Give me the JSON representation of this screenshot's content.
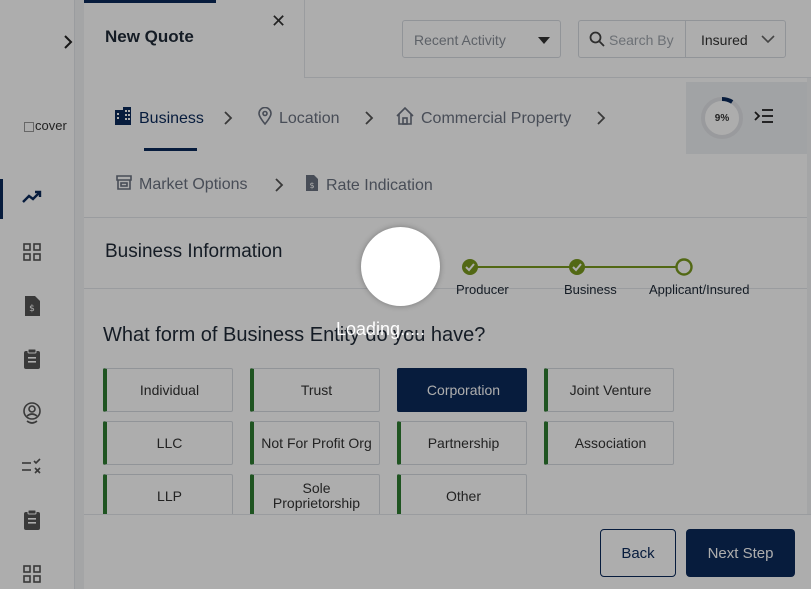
{
  "sidebar": {
    "logo_alt": "cover",
    "items": [
      {
        "icon": "trending-up-icon",
        "active": true
      },
      {
        "icon": "grid-icon",
        "active": false
      },
      {
        "icon": "document-dollar-icon",
        "active": false
      },
      {
        "icon": "clipboard-icon",
        "active": false
      },
      {
        "icon": "location-user-icon",
        "active": false
      },
      {
        "icon": "checklist-icon",
        "active": false
      },
      {
        "icon": "clipboard-icon",
        "active": false
      },
      {
        "icon": "grid-icon",
        "active": false
      }
    ]
  },
  "topbar": {
    "tab_title": "New Quote",
    "recent_activity": "Recent Activity",
    "search_placeholder": "Search By",
    "search_type": "Insured"
  },
  "steps": {
    "items": [
      {
        "label": "Business",
        "icon": "building-icon",
        "active": true
      },
      {
        "label": "Location",
        "icon": "map-pin-icon",
        "active": false
      },
      {
        "label": "Commercial Property",
        "icon": "home-icon",
        "active": false
      },
      {
        "label": "Market Options",
        "icon": "store-icon",
        "active": false
      },
      {
        "label": "Rate Indication",
        "icon": "document-dollar-icon",
        "active": false
      }
    ],
    "progress_percent": 9,
    "progress_label": "9%"
  },
  "section": {
    "title": "Business Information",
    "tracker": [
      "Producer",
      "Business",
      "Applicant/Insured"
    ],
    "tracker_done": [
      true,
      true,
      false
    ]
  },
  "question": "What form of Business Entity do you have?",
  "options": [
    [
      "Individual",
      "Trust",
      "Corporation",
      "Joint Venture"
    ],
    [
      "LLC",
      "Not For Profit Org",
      "Partnership",
      "Association"
    ],
    [
      "LLP",
      "Sole Proprietorship",
      "Other"
    ]
  ],
  "selected_option": "Corporation",
  "footer": {
    "back": "Back",
    "next": "Next Step"
  },
  "overlay": {
    "loading_text": "Loading....."
  },
  "colors": {
    "primary": "#0b2a5b",
    "accent_green": "#2e7d32",
    "tracker_green": "#7a9a1e"
  }
}
